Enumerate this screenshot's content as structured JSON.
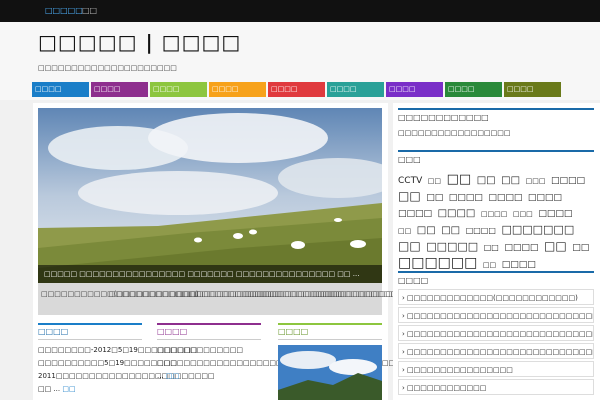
{
  "topnav": {
    "item1": "□□□□□",
    "item2": "□□"
  },
  "site": {
    "title": "□□□□□ | □□□□",
    "tagline": "□□□□□□□□□□□□□□□□□□□□□"
  },
  "categories": [
    {
      "label": "□□□□",
      "color": "#1a7ec8"
    },
    {
      "label": "□□□□",
      "color": "#8e2f8e"
    },
    {
      "label": "□□□□",
      "color": "#8dc63f"
    },
    {
      "label": "□□□□",
      "color": "#f7a21b"
    },
    {
      "label": "□□□□",
      "color": "#e03a3e"
    },
    {
      "label": "□□□□",
      "color": "#2aa198"
    },
    {
      "label": "□□□□",
      "color": "#7a2fc8"
    },
    {
      "label": "□□□□",
      "color": "#2a8a3a"
    },
    {
      "label": "□□□□",
      "color": "#6a7a1a"
    }
  ],
  "slider": {
    "caption": "□□□□□ □□□□□□□□□□□□□□□□ □□□□□□□ □□□□□□□□□□□□□□□ □□ ..."
  },
  "thumbs": [
    "□□□□□□□□□□□(□□□□□□□□□□□□)",
    "□□□□□□□□□□□□□□□□□□□□□□□□□□",
    "□□□□□□□□□□□□□□□□□□□□□□□□□",
    "□□□□□□□□□□□□□□□□□□□□□□□□□",
    "□□□□□□□□□□□□□□□□□□□□□□□□□"
  ],
  "sections": [
    {
      "title": "□□□□",
      "text": "□□□□□□□□-2012□5□19□□□□□□□□□ □□□□□□□□□□5□19□□□□□□□□ 2011□□□□□□□□□□□□□□□□□□□□□□□□ □□ ...",
      "more": "□□"
    },
    {
      "title": "□□□□",
      "text": "□□□□□□□□□□□□□ □□□□□□□□□□□□□□□□□□□□□□□□□□□□□□□□□□□□□□□□□□□□□□□□ ...",
      "more": "□□"
    },
    {
      "title": "□□□□",
      "text": "",
      "more": ""
    }
  ],
  "sidebar": {
    "widget1_title": "□□□□□□□□□□□□",
    "widget1_line": "□□□□□□□□□□□□□□□□□",
    "tags_title": "□□□",
    "tags": [
      "CCTV",
      "□□",
      "□□",
      "□□",
      "□□",
      "□□□",
      "□□□□",
      "□□",
      "□□",
      "□□□□",
      "□□□□",
      "□□□□",
      "□□□□",
      "□□□□",
      "□□□□",
      "□□□",
      "□□□□",
      "□□",
      "□□",
      "□□",
      "□□□□",
      "□□□□□□□",
      "□□",
      "□□□□□",
      "□□",
      "□□□□",
      "□□",
      "□□",
      "□□□□□□",
      "□□",
      "□□□□"
    ],
    "recent_title": "□□□□",
    "recent": [
      "□□□□□□□□□□□□□(□□□□□□□□□□□□)",
      "□□□□□□□□□□□□□□□□□□□□□□□□□□□□□□",
      "□□□□□□□□□□□□□□□□□□□□□□□□□□□□□□□□",
      "□□□□□□□□□□□□□□□□□□□□□□□□□□□□□□□□□□",
      "□□□□□□□□□□□□□□□□",
      "□□□□□□□□□□□□"
    ]
  }
}
